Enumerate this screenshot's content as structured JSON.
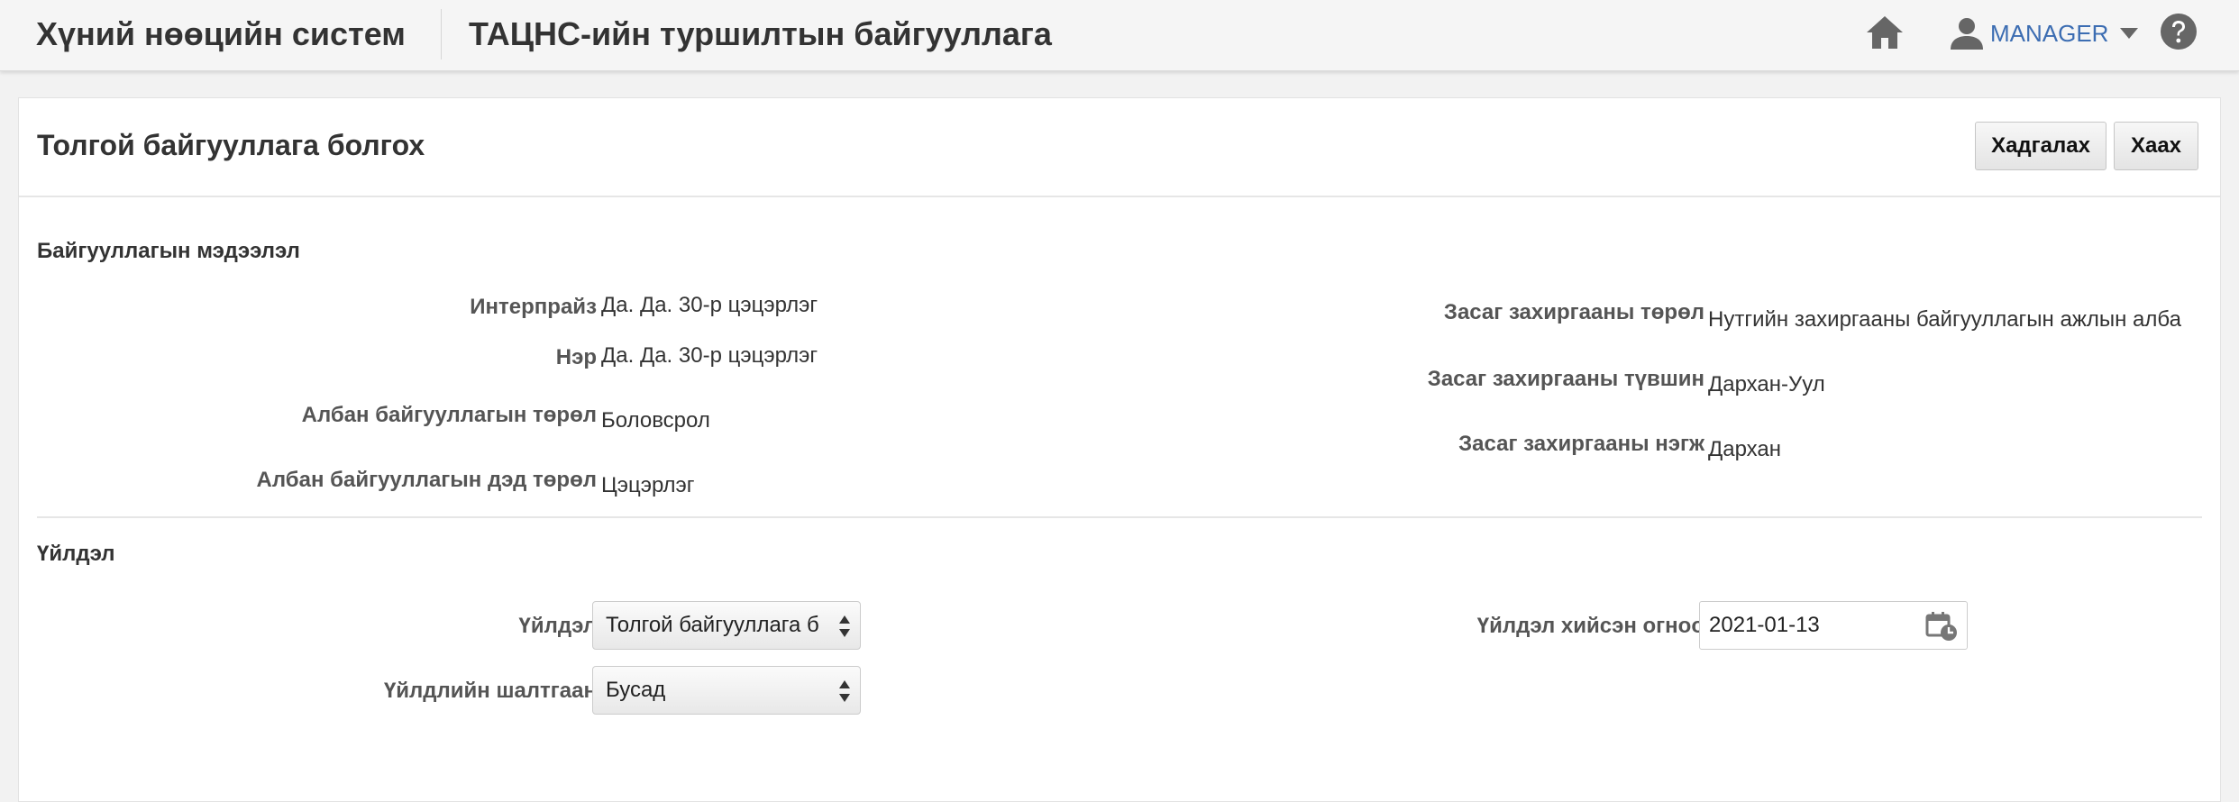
{
  "header": {
    "app_title": "Хүний нөөцийн систем",
    "org_title": "ТАЦНС-ийн туршилтын байгууллага",
    "user_name": "MANAGER"
  },
  "page": {
    "title": "Толгой байгууллага болгох",
    "save_label": "Хадгалах",
    "close_label": "Хаах"
  },
  "org_info": {
    "section_title": "Байгууллагын мэдээлэл",
    "enterprise_label": "Интерпрайз",
    "enterprise_value": "Да. Да. 30-р цэцэрлэг",
    "name_label": "Нэр",
    "name_value": "Да. Да. 30-р цэцэрлэг",
    "org_type_label": "Албан байгууллагын төрөл",
    "org_type_value": "Боловсрол",
    "org_subtype_label": "Албан байгууллагын дэд төрөл",
    "org_subtype_value": "Цэцэрлэг",
    "admin_type_label": "Засаг захиргааны төрөл",
    "admin_type_value": "Нутгийн захиргааны байгууллагын ажлын алба",
    "admin_level_label": "Засаг захиргааны түвшин",
    "admin_level_value": "Дархан-Уул",
    "admin_unit_label": "Засаг захиргааны нэгж",
    "admin_unit_value": "Дархан"
  },
  "action": {
    "section_title": "Үйлдэл",
    "action_label": "Үйлдэл",
    "action_value": "Толгой байгууллага б",
    "reason_label": "Үйлдлийн шалтгаан",
    "reason_value": "Бусад",
    "date_label": "Үйлдэл хийсэн огноо",
    "date_value": "2021-01-13"
  },
  "colors": {
    "accent": "#3c6db2",
    "icon": "#666666"
  }
}
